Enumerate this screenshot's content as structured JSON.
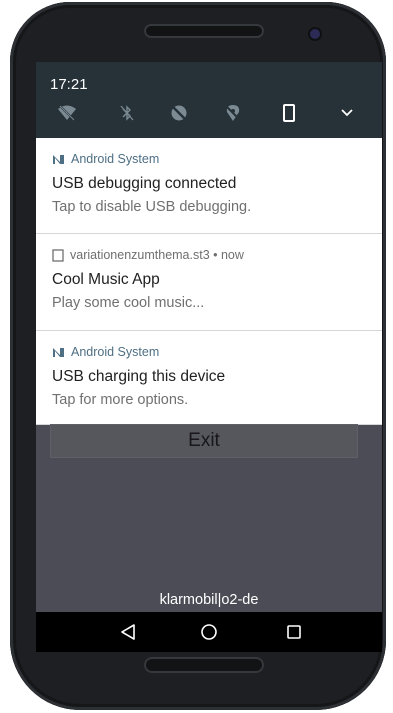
{
  "status_bar": {
    "time": "17:21"
  },
  "quick_settings": {
    "icons": [
      "wifi-off-icon",
      "bluetooth-off-icon",
      "do-not-disturb-icon",
      "location-off-icon",
      "portrait-rotation-icon",
      "expand-chevron-icon"
    ]
  },
  "notifications": [
    {
      "app": "Android System",
      "title": "USB debugging connected",
      "text": "Tap to disable USB debugging.",
      "icon": "android-system-icon"
    },
    {
      "app": "variationenzumthema.st3 • now",
      "title": "Cool Music App",
      "text": "Play some cool music...",
      "icon": "phone-app-icon"
    },
    {
      "app": "Android System",
      "title": "USB charging this device",
      "text": "Tap for more options.",
      "icon": "android-system-icon"
    }
  ],
  "app": {
    "exit_label": "Exit"
  },
  "carrier": "klarmobil|o2-de",
  "nav_bar": {
    "buttons": [
      "back-icon",
      "home-icon",
      "recents-icon"
    ]
  },
  "colors": {
    "status_bg": "#263238",
    "screen_bg": "#4b4c56",
    "android_accent": "#4e6f84"
  }
}
